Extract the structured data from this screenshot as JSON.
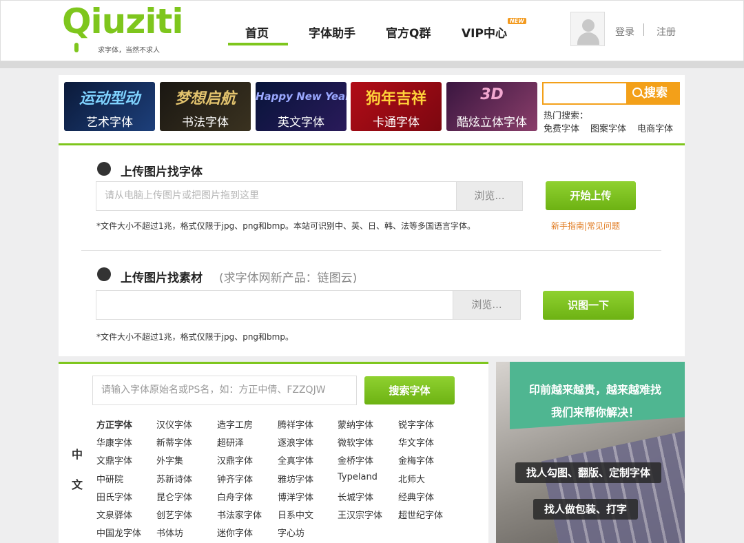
{
  "header": {
    "logo_text": "Qiuziti",
    "logo_slogan": "求字体，当然不求人",
    "nav": [
      {
        "label": "首页",
        "active": true
      },
      {
        "label": "字体助手"
      },
      {
        "label": "官方Q群"
      },
      {
        "label": "VIP中心",
        "badge": "NEW"
      }
    ],
    "login": "登录",
    "register": "注册",
    "accent_color": "#7ec61d"
  },
  "banners": [
    {
      "art": "运动型动",
      "label": "艺术字体"
    },
    {
      "art": "梦想启航",
      "label": "书法字体"
    },
    {
      "art": "Happy New Year",
      "label": "英文字体"
    },
    {
      "art": "狗年吉祥",
      "label": "卡通字体"
    },
    {
      "art": "3D",
      "label": "酷炫立体字体"
    }
  ],
  "search": {
    "button": "搜索",
    "hot_label": "热门搜索：",
    "hot_items": [
      "免费字体",
      "图案字体",
      "电商字体"
    ]
  },
  "upload_font": {
    "title": "上传图片找字体",
    "placeholder": "请从电脑上传图片或把图片拖到这里",
    "browse": "浏览...",
    "button": "开始上传",
    "note": "*文件大小不超过1兆，格式仅限于jpg、png和bmp。本站可识别中、英、日、韩、法等多国语言字体。",
    "help": "新手指南|常见问题"
  },
  "upload_material": {
    "title": "上传图片找素材",
    "subtitle": "(求字体网新产品：链图云)",
    "placeholder": "",
    "browse": "浏览...",
    "button": "识图一下",
    "note": "*文件大小不超过1兆，格式仅限于jpg、png和bmp。"
  },
  "font_search": {
    "placeholder": "请输入字体原始名或PS名，如：方正中倩、FZZQJW",
    "button": "搜索字体",
    "category_char1": "中",
    "category_char2": "文",
    "rows": [
      [
        "方正字体",
        "汉仪字体",
        "造字工房",
        "腾祥字体",
        "蒙纳字体",
        "锐字字体"
      ],
      [
        "华康字体",
        "新蒂字体",
        "超研泽",
        "逐浪字体",
        "微软字体",
        "华文字体"
      ],
      [
        "文鼎字体",
        "外字集",
        "汉鼎字体",
        "全真字体",
        "金桥字体",
        "金梅字体"
      ],
      [
        "中研院",
        "苏新诗体",
        "钟齐字体",
        "雅坊字体",
        "Typeland",
        "北师大"
      ],
      [
        "田氏字体",
        "昆仑字体",
        "白舟字体",
        "博洋字体",
        "长城字体",
        "经典字体"
      ],
      [
        "文泉驿体",
        "创艺字体",
        "书法家字体",
        "日系中文",
        "王汉宗字体",
        "超世纪字体"
      ],
      [
        "中国龙字体",
        "书体坊",
        "迷你字体",
        "字心坊"
      ]
    ]
  },
  "ad": {
    "line1": "印前越来越贵，越来越难找",
    "line2": "我们来帮你解决！",
    "tag1": "找人勾图、翻版、定制字体",
    "tag2": "找人做包装、打字"
  }
}
